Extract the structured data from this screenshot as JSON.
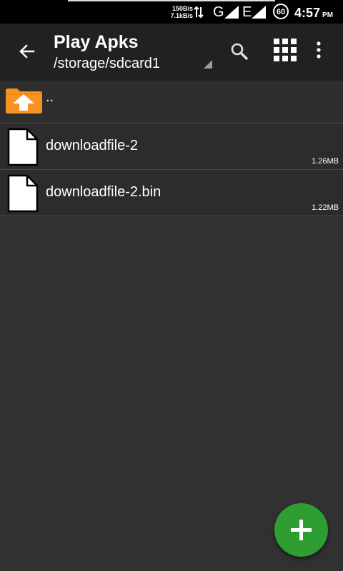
{
  "status_bar": {
    "net_up": "150B/s",
    "net_down": "7.1kB/s",
    "signal_1_label": "G",
    "signal_2_label": "E",
    "battery_level": "60",
    "time": "4:57",
    "ampm": "PM"
  },
  "app_bar": {
    "title": "Play Apks",
    "path": "/storage/sdcard1",
    "icons": [
      "back-arrow-icon",
      "search-icon",
      "grid-view-icon",
      "more-vert-icon"
    ]
  },
  "parent_item": {
    "name": ".."
  },
  "files": [
    {
      "name": "downloadfile-2",
      "size": "1.26MB"
    },
    {
      "name": "downloadfile-2.bin",
      "size": "1.22MB"
    }
  ],
  "colors": {
    "background": "#313131",
    "app_bar": "#212121",
    "folder": "#F7931E",
    "fab": "#2E9E33"
  }
}
